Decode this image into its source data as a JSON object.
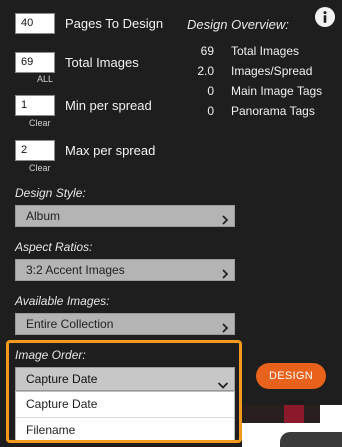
{
  "settings": {
    "pages_to_design": {
      "value": "40",
      "label": "Pages To Design"
    },
    "total_images": {
      "value": "69",
      "label": "Total Images",
      "sub": "ALL"
    },
    "min_per_spread": {
      "value": "1",
      "label": "Min per spread",
      "sub": "Clear"
    },
    "max_per_spread": {
      "value": "2",
      "label": "Max per spread",
      "sub": "Clear"
    }
  },
  "overview": {
    "title": "Design Overview:",
    "rows": [
      {
        "value": "69",
        "label": "Total Images"
      },
      {
        "value": "2.0",
        "label": "Images/Spread"
      },
      {
        "value": "0",
        "label": "Main Image Tags"
      },
      {
        "value": "0",
        "label": "Panorama Tags"
      }
    ]
  },
  "design_style": {
    "title": "Design Style:",
    "selected": "Album"
  },
  "aspect_ratios": {
    "title": "Aspect Ratios:",
    "selected": "3:2 Accent Images"
  },
  "available_images": {
    "title": "Available Images:",
    "selected": "Entire Collection"
  },
  "image_order": {
    "title": "Image Order:",
    "selected": "Capture Date",
    "options": [
      "Capture Date",
      "Filename"
    ]
  },
  "design_button": {
    "label": "DESIGN"
  },
  "colors": {
    "background": "#1e1e1e",
    "accent": "#e8621c",
    "highlight": "#f39a1e"
  },
  "icons": [
    "info-icon",
    "chevron-right-icon",
    "chevron-down-icon"
  ]
}
